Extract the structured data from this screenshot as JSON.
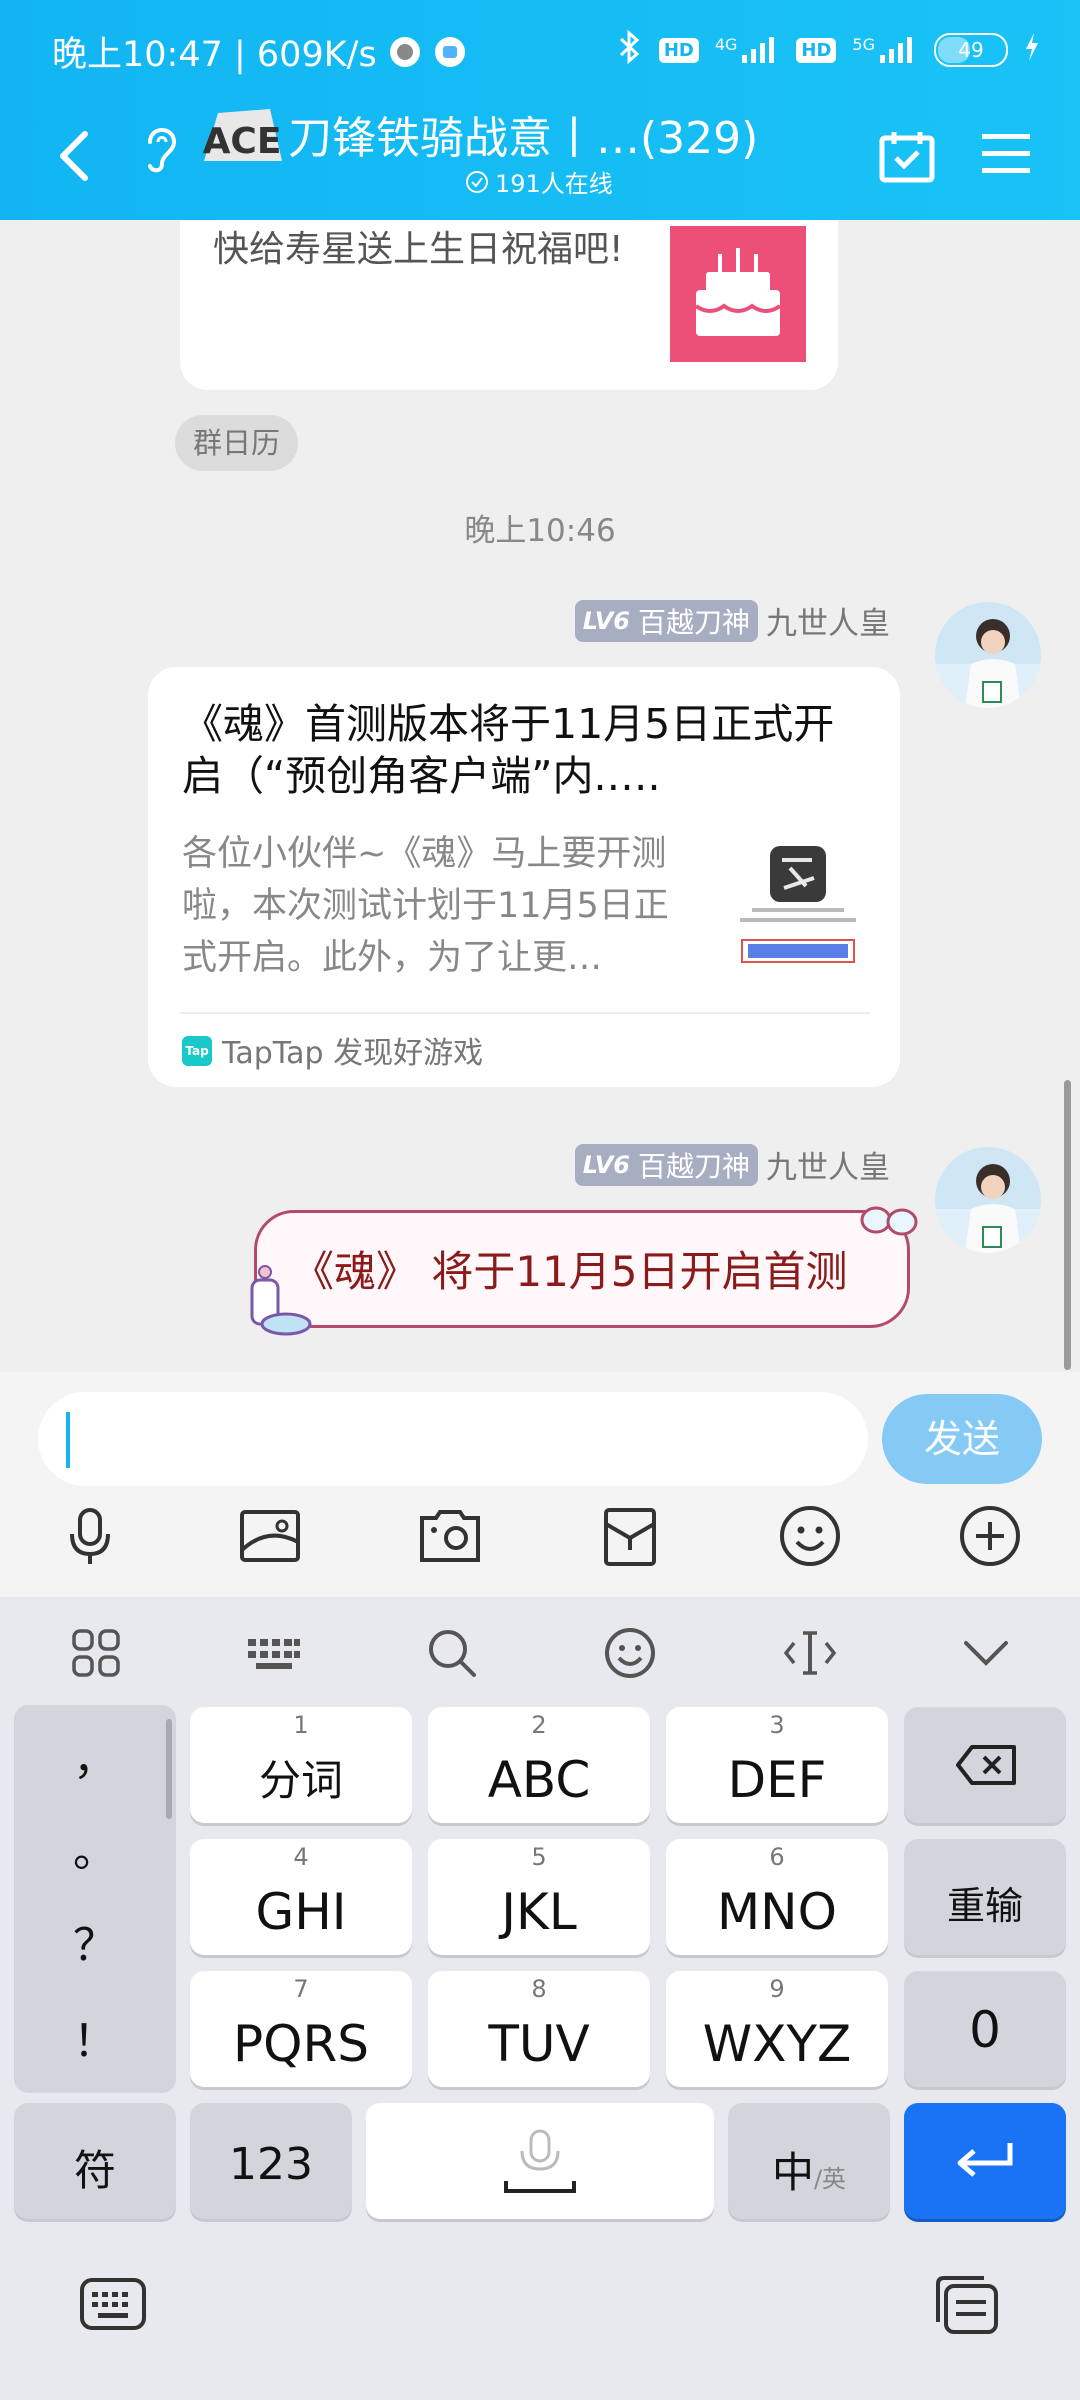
{
  "status_bar": {
    "time_speed": "晚上10:47 | 609K/s",
    "hd1": "HD",
    "net1": "4G",
    "hd2": "HD",
    "net2": "5G",
    "battery": "49"
  },
  "header": {
    "group_title": "刀锋铁骑战意丨…(329)",
    "group_logo": "ACE",
    "online_count": "191人在线"
  },
  "chat": {
    "birthday_text": "快给寿星送上生日祝福吧!",
    "calendar_tag": "群日历",
    "time_label": "晚上10:46",
    "messages": [
      {
        "level": "LV6",
        "title": "百越刀神",
        "sender": "九世人皇",
        "card": {
          "title": "《魂》首测版本将于11月5日正式开启（“预创角客户端”内.….",
          "description": "各位小伙伴~《魂》马上要开测啦，本次测试计划于11月5日正式开启。此外，为了让更…",
          "source": "TapTap 发现好游戏",
          "source_icon": "Tap"
        }
      },
      {
        "level": "LV6",
        "title": "百越刀神",
        "sender": "九世人皇",
        "text": "《魂》 将于11月5日开启首测"
      }
    ]
  },
  "input": {
    "placeholder": "",
    "value": "",
    "send_label": "发送",
    "tools": [
      "microphone-icon",
      "image-icon",
      "camera-icon",
      "red-packet-icon",
      "emoji-icon",
      "plus-icon"
    ]
  },
  "keyboard": {
    "toolbar": [
      "grid-icon",
      "keyboard-icon",
      "search-icon",
      "emoji-icon",
      "cursor-icon",
      "collapse-icon"
    ],
    "punctuation": [
      "，",
      "。",
      "？",
      "！"
    ],
    "keys": [
      {
        "num": "1",
        "label": "分词"
      },
      {
        "num": "2",
        "label": "ABC"
      },
      {
        "num": "3",
        "label": "DEF"
      },
      {
        "num": "4",
        "label": "GHI"
      },
      {
        "num": "5",
        "label": "JKL"
      },
      {
        "num": "6",
        "label": "MNO"
      },
      {
        "num": "7",
        "label": "PQRS"
      },
      {
        "num": "8",
        "label": "TUV"
      },
      {
        "num": "9",
        "label": "WXYZ"
      }
    ],
    "retype": "重输",
    "zero": "0",
    "symbol": "符",
    "numeric": "123",
    "lang_main": "中",
    "lang_alt": "/英"
  },
  "colors": {
    "header": "#15b8f3",
    "send_button": "#85caf4",
    "enter_key": "#1a73f5",
    "sticker_text": "#8b1b1b"
  }
}
